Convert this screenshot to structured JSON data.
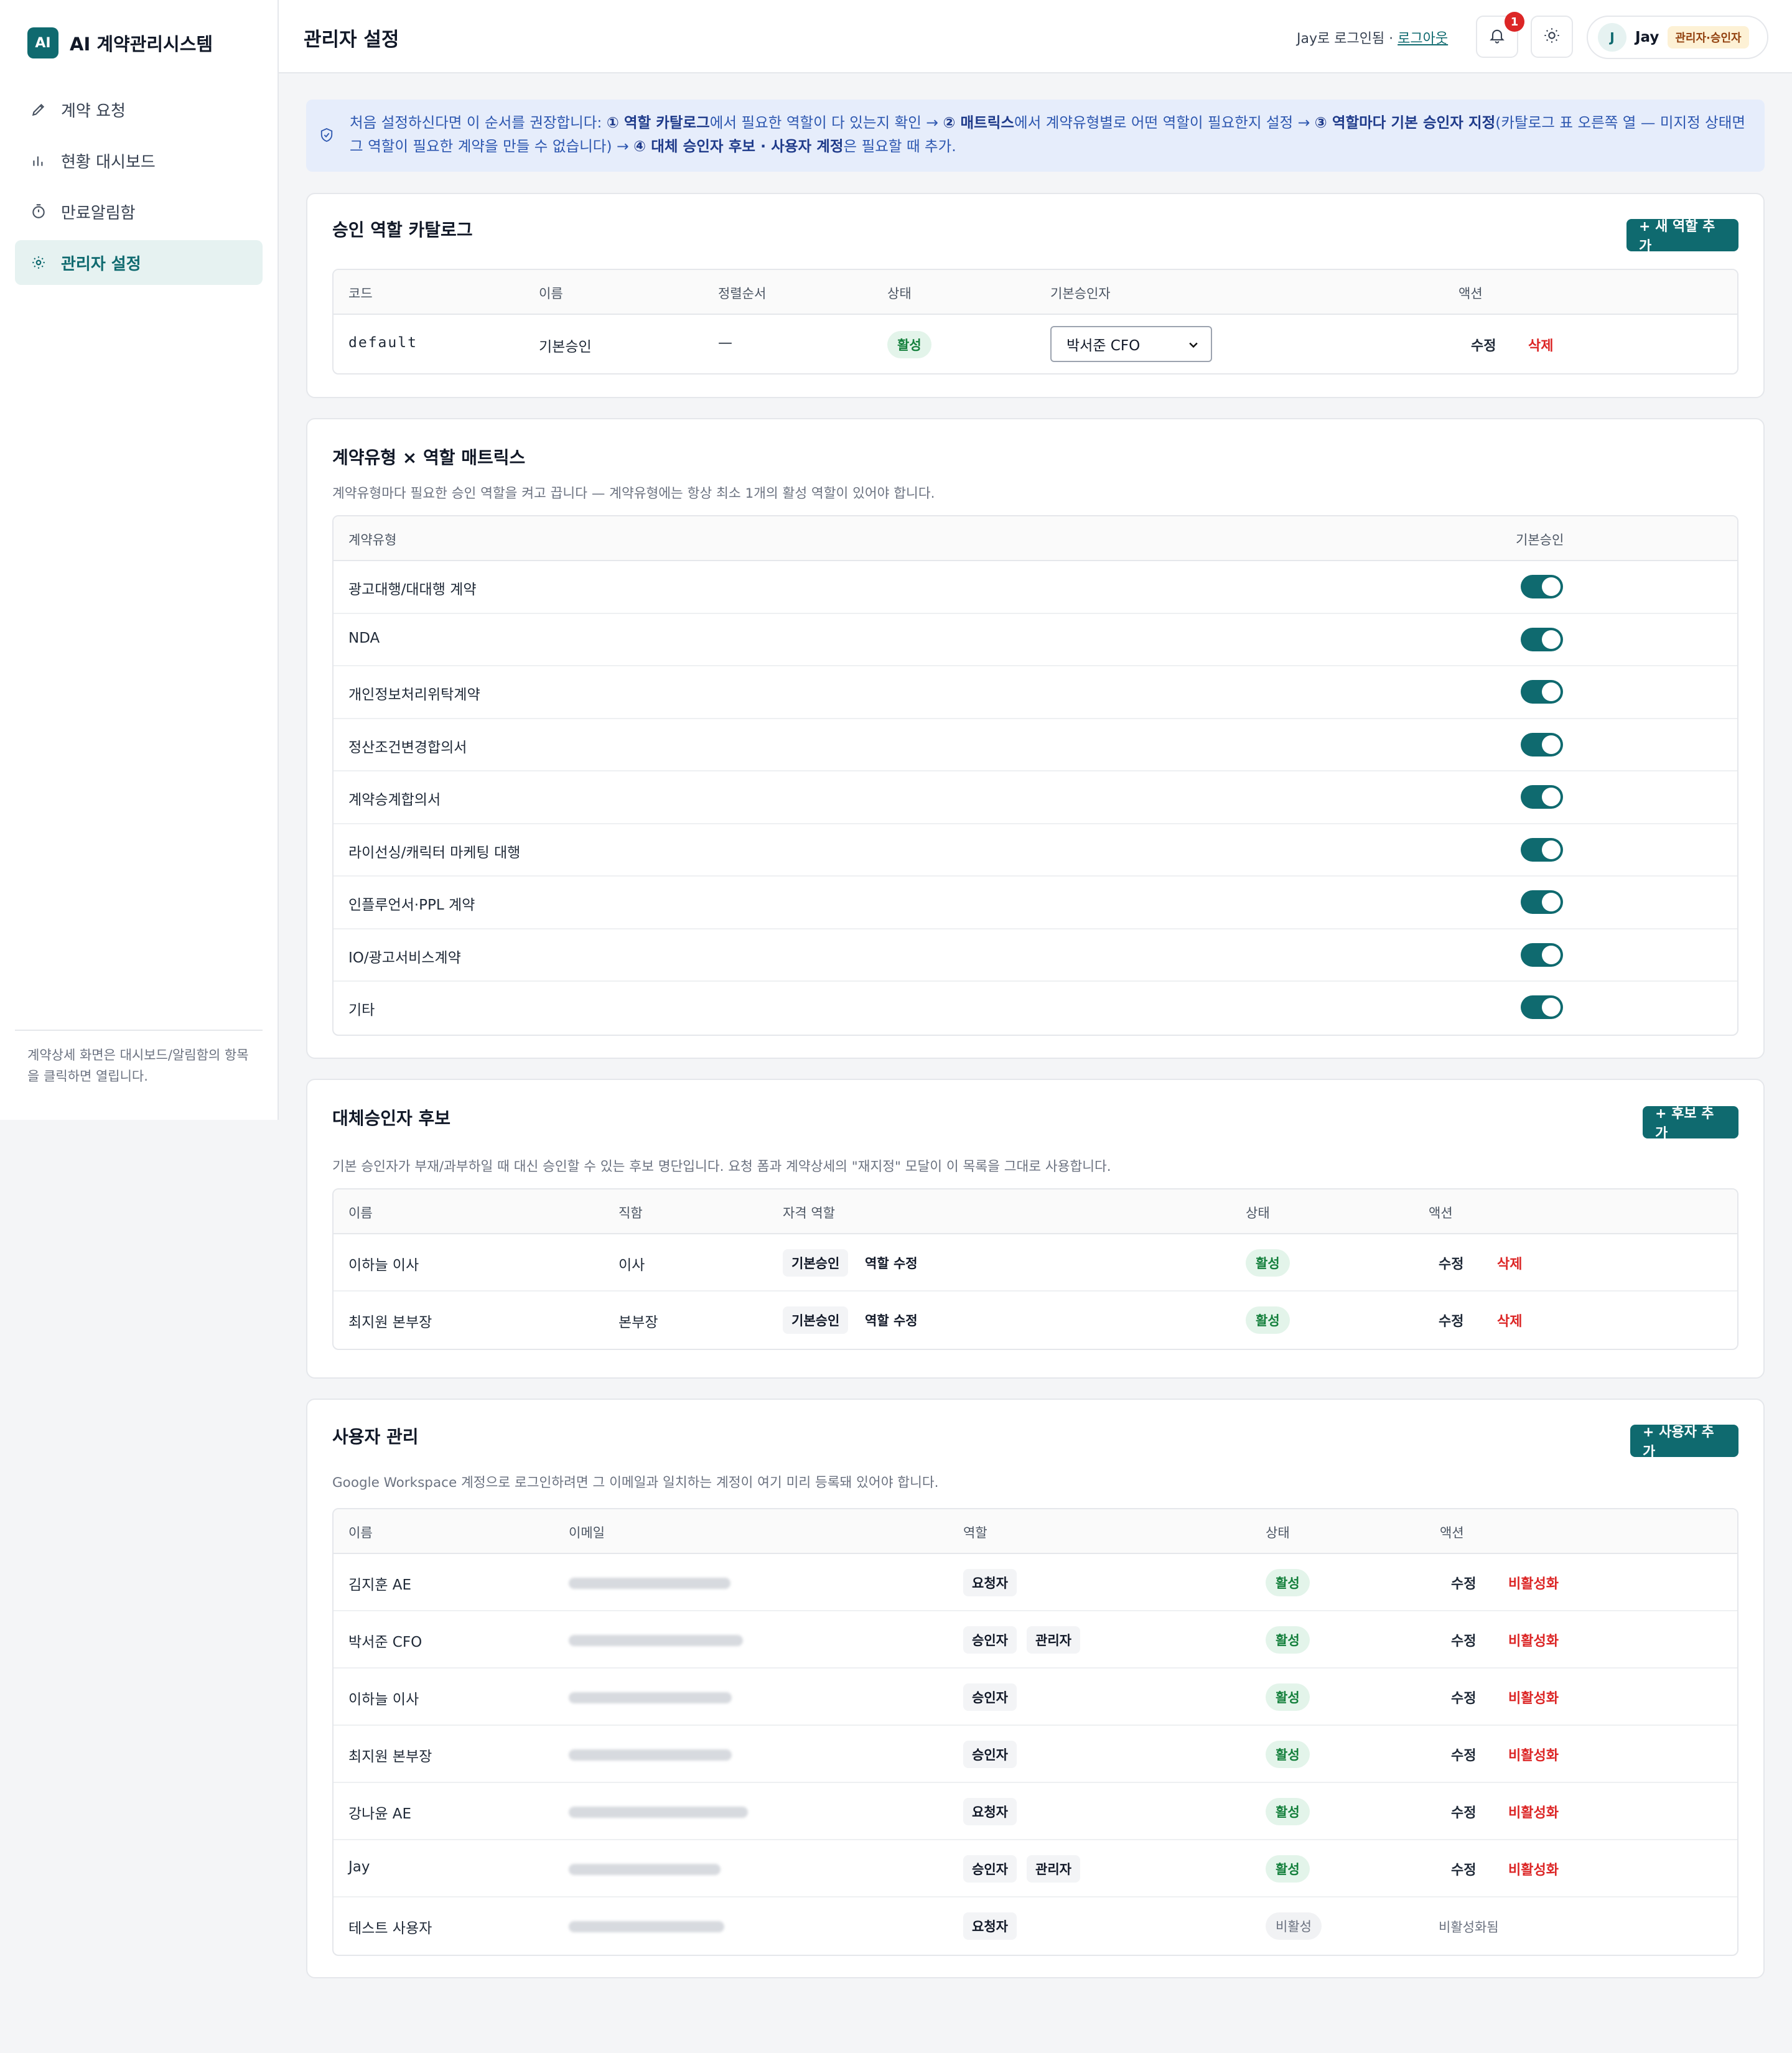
{
  "app": {
    "logo": "AI",
    "name": "AI 계약관리시스템"
  },
  "sidebar": {
    "items": [
      {
        "label": "계약 요청",
        "icon": "pencil-icon"
      },
      {
        "label": "현황 대시보드",
        "icon": "bar-chart-icon"
      },
      {
        "label": "만료알림함",
        "icon": "timer-icon"
      },
      {
        "label": "관리자 설정",
        "icon": "gear-icon"
      }
    ],
    "active_index": 3,
    "footer": "계약상세 화면은 대시보드/알림함의 항목을 클릭하면 열립니다."
  },
  "header": {
    "title": "관리자 설정",
    "login_text": "Jay로 로그인됨 · ",
    "logout": "로그아웃",
    "notification_count": "1",
    "user_initial": "J",
    "user_name": "Jay",
    "user_role": "관리자·승인자"
  },
  "banner": {
    "t1": "처음 설정하신다면 이 순서를 권장합니다: ",
    "b1": "① 역할 카탈로그",
    "t2": "에서 필요한 역할이 다 있는지 확인 → ",
    "b2": "② 매트릭스",
    "t3": "에서 계약유형별로 어떤 역할이 필요한지 설정 → ",
    "b3": "③ 역할마다 기본 승인자 지정",
    "t4": "(카탈로그 표 오른쪽 열 — 미지정 상태면 그 역할이 필요한 계약을 만들 수 없습니다) → ",
    "b4": "④ 대체 승인자 후보 · 사용자 계정",
    "t5": "은 필요할 때 추가."
  },
  "catalog": {
    "title": "승인 역할 카탈로그",
    "add_button": "+ 새 역할 추가",
    "columns": [
      "코드",
      "이름",
      "정렬순서",
      "상태",
      "기본승인자",
      "액션"
    ],
    "rows": [
      {
        "code": "default",
        "name": "기본승인",
        "order": "—",
        "status": "활성",
        "approver": "박서준 CFO",
        "edit": "수정",
        "delete": "삭제"
      }
    ]
  },
  "matrix": {
    "title": "계약유형 × 역할 매트릭스",
    "desc": "계약유형마다 필요한 승인 역할을 켜고 끕니다 — 계약유형에는 항상 최소 1개의 활성 역할이 있어야 합니다.",
    "col_type": "계약유형",
    "col_role": "기본승인",
    "rows": [
      {
        "type": "광고대행/대대행 계약",
        "on": true
      },
      {
        "type": "NDA",
        "on": true
      },
      {
        "type": "개인정보처리위탁계약",
        "on": true
      },
      {
        "type": "정산조건변경합의서",
        "on": true
      },
      {
        "type": "계약승계합의서",
        "on": true
      },
      {
        "type": "라이선싱/캐릭터 마케팅 대행",
        "on": true
      },
      {
        "type": "인플루언서·PPL 계약",
        "on": true
      },
      {
        "type": "IO/광고서비스계약",
        "on": true
      },
      {
        "type": "기타",
        "on": true
      }
    ]
  },
  "alternates": {
    "title": "대체승인자 후보",
    "add_button": "+ 후보 추가",
    "desc": "기본 승인자가 부재/과부하일 때 대신 승인할 수 있는 후보 명단입니다. 요청 폼과 계약상세의 \"재지정\" 모달이 이 목록을 그대로 사용합니다.",
    "columns": [
      "이름",
      "직함",
      "자격 역할",
      "상태",
      "액션"
    ],
    "rows": [
      {
        "name": "이하늘 이사",
        "title": "이사",
        "role": "기본승인",
        "role_edit": "역할 수정",
        "status": "활성",
        "edit": "수정",
        "delete": "삭제"
      },
      {
        "name": "최지원 본부장",
        "title": "본부장",
        "role": "기본승인",
        "role_edit": "역할 수정",
        "status": "활성",
        "edit": "수정",
        "delete": "삭제"
      }
    ]
  },
  "users": {
    "title": "사용자 관리",
    "add_button": "+ 사용자 추가",
    "desc": "Google Workspace 계정으로 로그인하려면 그 이메일과 일치하는 계정이 여기 미리 등록돼 있어야 합니다.",
    "columns": [
      "이름",
      "이메일",
      "역할",
      "상태",
      "액션"
    ],
    "rows": [
      {
        "name": "김지훈 AE",
        "roles": [
          "요청자"
        ],
        "status": "활성",
        "active": true,
        "edit": "수정",
        "action": "비활성화"
      },
      {
        "name": "박서준 CFO",
        "roles": [
          "승인자",
          "관리자"
        ],
        "status": "활성",
        "active": true,
        "edit": "수정",
        "action": "비활성화"
      },
      {
        "name": "이하늘 이사",
        "roles": [
          "승인자"
        ],
        "status": "활성",
        "active": true,
        "edit": "수정",
        "action": "비활성화"
      },
      {
        "name": "최지원 본부장",
        "roles": [
          "승인자"
        ],
        "status": "활성",
        "active": true,
        "edit": "수정",
        "action": "비활성화"
      },
      {
        "name": "강나윤 AE",
        "roles": [
          "요청자"
        ],
        "status": "활성",
        "active": true,
        "edit": "수정",
        "action": "비활성화"
      },
      {
        "name": "Jay",
        "roles": [
          "승인자",
          "관리자"
        ],
        "status": "활성",
        "active": true,
        "edit": "수정",
        "action": "비활성화"
      },
      {
        "name": "테스트 사용자",
        "roles": [
          "요청자"
        ],
        "status": "비활성",
        "active": false,
        "edit": "",
        "action": "비활성화됨"
      }
    ]
  }
}
